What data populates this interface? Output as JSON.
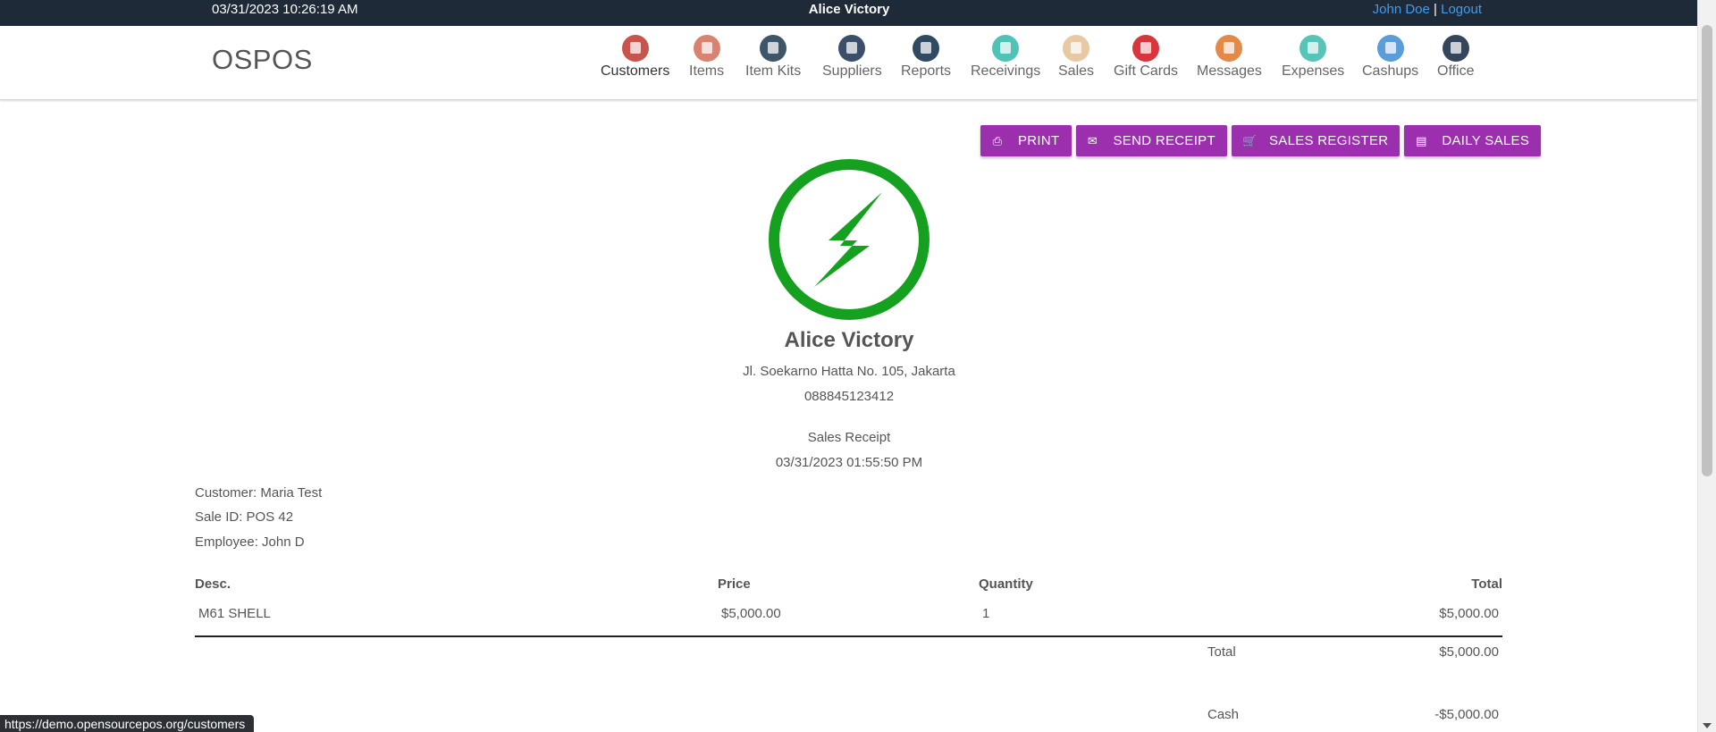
{
  "topbar": {
    "datetime": "03/31/2023 10:26:19 AM",
    "store_name": "Alice Victory",
    "user": "John Doe",
    "separator": "|",
    "logout": "Logout"
  },
  "navbar": {
    "brand": "OSPOS",
    "items": [
      {
        "label": "Customers",
        "icon": "customers-icon",
        "color": "#c9544b"
      },
      {
        "label": "Items",
        "icon": "items-icon",
        "color": "#d9826f"
      },
      {
        "label": "Item Kits",
        "icon": "item-kits-icon",
        "color": "#3e5668"
      },
      {
        "label": "Suppliers",
        "icon": "suppliers-icon",
        "color": "#3c4f6a"
      },
      {
        "label": "Reports",
        "icon": "reports-icon",
        "color": "#2f4a61"
      },
      {
        "label": "Receivings",
        "icon": "receivings-icon",
        "color": "#4fc3b7"
      },
      {
        "label": "Sales",
        "icon": "sales-icon",
        "color": "#f0e3cf"
      },
      {
        "label": "Gift Cards",
        "icon": "gift-cards-icon",
        "color": "#d8353d"
      },
      {
        "label": "Messages",
        "icon": "messages-icon",
        "color": "#e38a49"
      },
      {
        "label": "Expenses",
        "icon": "expenses-icon",
        "color": "#56c4b6"
      },
      {
        "label": "Cashups",
        "icon": "cashups-icon",
        "color": "#5b9dd9"
      },
      {
        "label": "Office",
        "icon": "office-icon",
        "color": "#35465c"
      }
    ]
  },
  "buttons": {
    "print": "PRINT",
    "send_receipt": "SEND RECEIPT",
    "sales_register": "SALES REGISTER",
    "daily_sales": "DAILY SALES"
  },
  "receipt": {
    "company_name": "Alice Victory",
    "address": "Jl. Soekarno Hatta No. 105, Jakarta",
    "phone": "088845123412",
    "title": "Sales Receipt",
    "date": "03/31/2023 01:55:50 PM",
    "customer": "Customer: Maria Test",
    "sale_id": "Sale ID: POS 42",
    "employee": "Employee: John D",
    "columns": {
      "desc": "Desc.",
      "price": "Price",
      "quantity": "Quantity",
      "total": "Total"
    },
    "items": [
      {
        "desc": "M61 SHELL",
        "price": "$5,000.00",
        "quantity": "1",
        "total": "$5,000.00"
      }
    ],
    "total_label": "Total",
    "total_value": "$5,000.00",
    "payment_label": "Cash",
    "payment_value": "-$5,000.00"
  },
  "statusbar": {
    "url": "https://demo.opensourcepos.org/customers"
  },
  "colors": {
    "topbar_bg": "#1e2a38",
    "link": "#3d9cf0",
    "button": "#9b2fae",
    "logo_green": "#16a01f"
  }
}
